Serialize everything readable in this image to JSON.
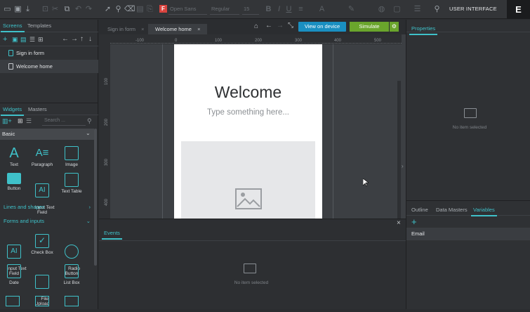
{
  "toolbar": {
    "font_family": "Open Sans",
    "font_weight": "Regular",
    "font_size": "15",
    "mode_label": "USER INTERFACE",
    "badge": "E"
  },
  "left": {
    "tabs": [
      "Screens",
      "Templates"
    ],
    "screens": [
      "Sign in form",
      "Welcome home"
    ],
    "widget_tabs": [
      "Widgets",
      "Masters"
    ],
    "search_placeholder": "Search ...",
    "category": "Basic",
    "basic_widgets": [
      "Text",
      "Paragraph",
      "Image",
      "Button",
      "Input Text\nField",
      "Text Table"
    ],
    "sections": [
      "Lines and shapes",
      "Forms and inputs"
    ],
    "form_widgets": [
      "Input Text\nField",
      "Check Box",
      "Radio\nButton",
      "Date",
      "File\nUpload",
      "List Box"
    ]
  },
  "center": {
    "file_tabs": [
      "Sign in form",
      "Welcome home"
    ],
    "view_on_device": "View on device",
    "simulate": "Simulate",
    "ruler_top": [
      "-100",
      "0",
      "100",
      "200",
      "300",
      "400",
      "500"
    ],
    "ruler_left": [
      "100",
      "200",
      "300",
      "400"
    ],
    "device": {
      "title": "Welcome",
      "subtitle": "Type something here..."
    },
    "events_tab": "Events",
    "events_empty": "No item selected"
  },
  "right": {
    "properties_tab": "Properties",
    "properties_empty": "No item selected",
    "bottom_tabs": [
      "Outline",
      "Data Masters",
      "Variables"
    ],
    "variable": "Email"
  },
  "colors": {
    "accent": "#3fc1c9",
    "device_button": "#1a8fc1",
    "simulate_button": "#6aa52c"
  }
}
